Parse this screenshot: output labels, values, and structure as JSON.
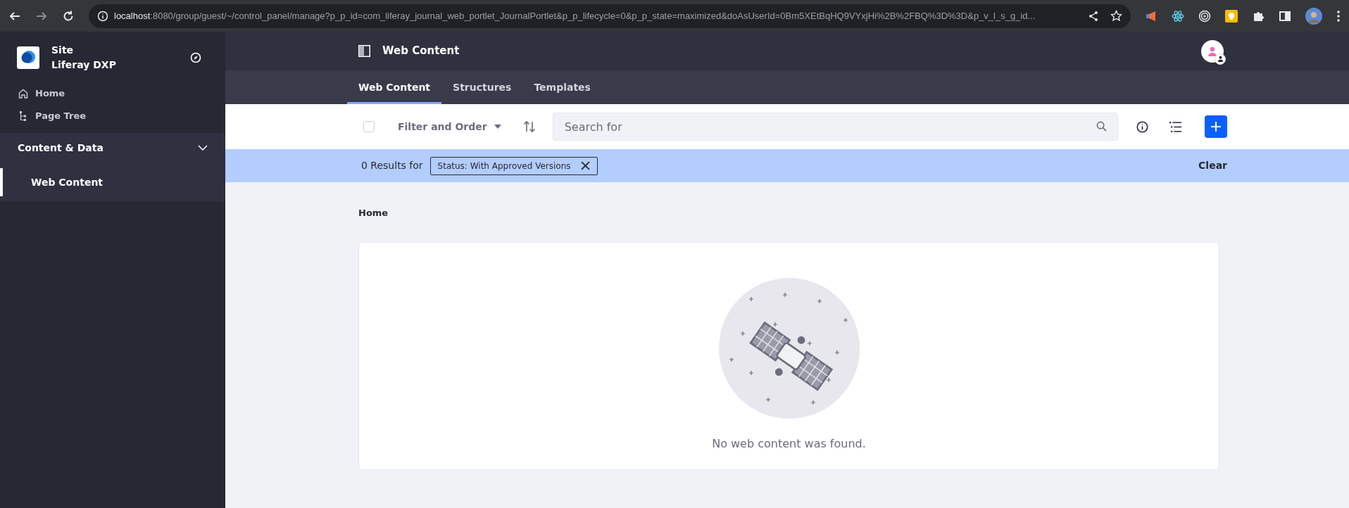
{
  "browser": {
    "url_host": "localhost",
    "url_path": ":8080/group/guest/~/control_panel/manage?p_p_id=com_liferay_journal_web_portlet_JournalPortlet&p_p_lifecycle=0&p_p_state=maximized&doAsUserId=0Bm5XEtBqHQ9VYxjHi%2B%2FBQ%3D%3D&p_v_l_s_g_id..."
  },
  "sidebar": {
    "site_label": "Site",
    "site_name": "Liferay DXP",
    "nav": [
      {
        "label": "Home",
        "kind": "home"
      },
      {
        "label": "Page Tree",
        "kind": "tree"
      }
    ],
    "section": {
      "label": "Content & Data",
      "expanded": true,
      "items": [
        {
          "label": "Web Content",
          "selected": true
        }
      ]
    }
  },
  "header": {
    "title": "Web Content"
  },
  "tabs": [
    {
      "label": "Web Content",
      "selected": true
    },
    {
      "label": "Structures",
      "selected": false
    },
    {
      "label": "Templates",
      "selected": false
    }
  ],
  "toolbar": {
    "select_all_checked": false,
    "filter_label": "Filter and Order",
    "search_placeholder": "Search for"
  },
  "results": {
    "count_text": "0 Results for",
    "filter_tag": "Status: With Approved Versions",
    "clear": "Clear"
  },
  "breadcrumb": "Home",
  "empty_message": "No web content was found."
}
